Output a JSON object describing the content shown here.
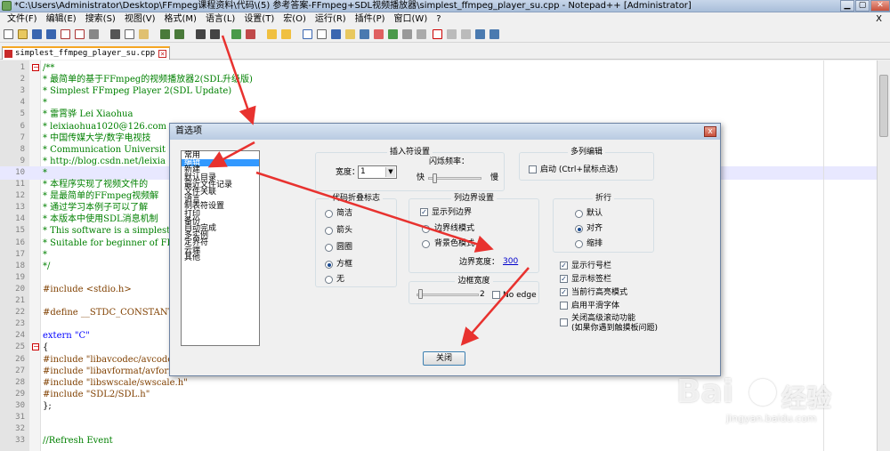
{
  "window": {
    "title": "*C:\\Users\\Administrator\\Desktop\\FFmpeg课程资料\\代码\\(5) 参考答案-FFmpeg+SDL视频播放器\\simplest_ffmpeg_player_su.cpp - Notepad++ [Administrator]"
  },
  "menu": {
    "items": [
      "文件(F)",
      "编辑(E)",
      "搜索(S)",
      "视图(V)",
      "格式(M)",
      "语言(L)",
      "设置(T)",
      "宏(O)",
      "运行(R)",
      "插件(P)",
      "窗口(W)",
      "?"
    ],
    "close_x": "X"
  },
  "tab": {
    "label": "simplest_ffmpeg_player_su.cpp"
  },
  "editor": {
    "lines": [
      {
        "n": "1",
        "text": "/**"
      },
      {
        "n": "2",
        "text": " * 最简单的基于FFmpeg的视频播放器2(SDL升级版)"
      },
      {
        "n": "3",
        "text": " * Simplest FFmpeg Player 2(SDL Update)"
      },
      {
        "n": "4",
        "text": " *"
      },
      {
        "n": "5",
        "text": " * 雷霄骅 Lei Xiaohua"
      },
      {
        "n": "6",
        "text": " * leixiaohua1020@126.com"
      },
      {
        "n": "7",
        "text": " * 中国传媒大学/数字电视技"
      },
      {
        "n": "8",
        "text": " * Communication Universit"
      },
      {
        "n": "9",
        "text": " * http://blog.csdn.net/leixia"
      },
      {
        "n": "10",
        "text": " *"
      },
      {
        "n": "11",
        "text": " * 本程序实现了视频文件的"
      },
      {
        "n": "12",
        "text": " * 是最简单的FFmpeg视频解"
      },
      {
        "n": "13",
        "text": " * 通过学习本例子可以了解"
      },
      {
        "n": "14",
        "text": " * 本版本中使用SDL消息机制"
      },
      {
        "n": "15",
        "text": " * This software is a simplest"
      },
      {
        "n": "16",
        "text": " * Suitable for beginner of FF"
      },
      {
        "n": "17",
        "text": " *"
      },
      {
        "n": "18",
        "text": " */"
      },
      {
        "n": "19",
        "text": ""
      },
      {
        "n": "20",
        "text": "#include <stdio.h>"
      },
      {
        "n": "21",
        "text": ""
      },
      {
        "n": "22",
        "text": "#define __STDC_CONSTANT"
      },
      {
        "n": "23",
        "text": ""
      },
      {
        "n": "24",
        "text": "extern \"C\""
      },
      {
        "n": "25",
        "text": "{"
      },
      {
        "n": "26",
        "text": "#include \"libavcodec/avcodec"
      },
      {
        "n": "27",
        "text": "#include \"libavformat/avforr"
      },
      {
        "n": "28",
        "text": "#include \"libswscale/swscale.h\""
      },
      {
        "n": "29",
        "text": "#include \"SDL2/SDL.h\""
      },
      {
        "n": "30",
        "text": "};"
      },
      {
        "n": "31",
        "text": ""
      },
      {
        "n": "32",
        "text": ""
      },
      {
        "n": "33",
        "text": "//Refresh Event"
      }
    ]
  },
  "dialog": {
    "title": "首选项",
    "close_glyph": "x",
    "categories": [
      "常用",
      "编辑",
      "新建",
      "默认目录",
      "最近文件记录",
      "文件关联",
      "语言",
      "制表符设置",
      "打印",
      "备份",
      "自动完成",
      "多实例",
      "定界符",
      "云端",
      "其他"
    ],
    "selected_category": "编辑",
    "caret": {
      "title": "插入符设置",
      "width_label": "宽度：",
      "width_value": "1",
      "blink_label": "闪烁频率：",
      "fast": "快",
      "slow": "慢"
    },
    "multi_edit": {
      "title": "多列编辑",
      "enable_label": "启动 (Ctrl+鼠标点选)"
    },
    "folding": {
      "title": "代码折叠标志",
      "options": [
        "简洁",
        "箭头",
        "圆圈",
        "方框",
        "无"
      ],
      "selected": "方框"
    },
    "edge": {
      "title": "列边界设置",
      "show_label": "显示列边界",
      "line_mode": "边界线模式",
      "bg_mode": "背景色模式",
      "width_label": "边界宽度：",
      "width_value": "300"
    },
    "wrap": {
      "title": "折行",
      "options": [
        "默认",
        "对齐",
        "缩排"
      ],
      "selected": "对齐"
    },
    "border": {
      "title": "边框宽度",
      "value": "2",
      "no_edge_label": "No edge"
    },
    "options": [
      {
        "label": "显示行号栏",
        "checked": true
      },
      {
        "label": "显示标签栏",
        "checked": true
      },
      {
        "label": "当前行高亮模式",
        "checked": true
      },
      {
        "label": "启用平滑字体",
        "checked": false
      },
      {
        "label": "关闭高级滚动功能",
        "checked": false
      }
    ],
    "advanced_scroll_note": "(如果你遇到触摸板问题)",
    "close_button": "关闭"
  },
  "watermark": {
    "brand": "Bai",
    "brand_tail": "经验",
    "url": "jingyan.baidu.com"
  },
  "colors": {
    "accent_arrow": "#e8322f",
    "selection": "#3399ff",
    "comment": "#008000",
    "preprocessor": "#804000",
    "keyword": "#0000ff"
  }
}
